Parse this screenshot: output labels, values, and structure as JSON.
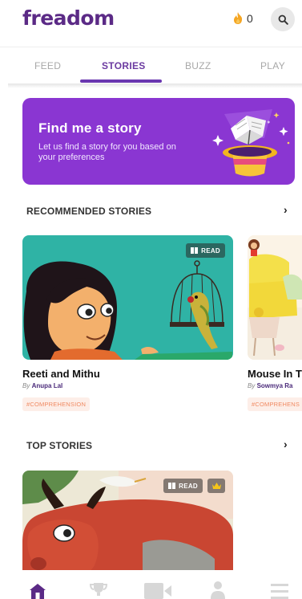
{
  "header": {
    "logo_text": "freadom",
    "coins_count": "0",
    "icons": {
      "coins": "flame-icon",
      "search": "search-icon"
    }
  },
  "tabs": [
    {
      "label": "FEED",
      "active": false
    },
    {
      "label": "STORIES",
      "active": true
    },
    {
      "label": "BUZZ",
      "active": false
    },
    {
      "label": "PLAY",
      "active": false
    }
  ],
  "banner": {
    "title": "Find me a story",
    "subtitle": "Let us find a story for you based on your preferences",
    "icon": "magic-hat-book-icon",
    "background_color": "#8a36d2"
  },
  "recommended": {
    "title": "RECOMMENDED STORIES",
    "chevron": "›",
    "cards": [
      {
        "title": "Reeti and Mithu",
        "by_label": "By",
        "author": "Anupa Lal",
        "tag": "#COMPREHENSION",
        "badge": "READ"
      },
      {
        "title": "Mouse In T",
        "by_label": "By",
        "author": "Sowmya Ra",
        "tag": "#COMPREHENS",
        "badge": ""
      }
    ]
  },
  "top_stories": {
    "title": "TOP STORIES",
    "chevron": "›",
    "cards": [
      {
        "badge": "READ",
        "premium_icon": "crown-icon"
      }
    ]
  },
  "bottom_nav": {
    "items": [
      {
        "icon": "home-icon",
        "active": true
      },
      {
        "icon": "trophy-icon",
        "active": false
      },
      {
        "icon": "video-camera-icon",
        "active": false
      },
      {
        "icon": "profile-icon",
        "active": false
      },
      {
        "icon": "menu-icon",
        "active": false
      }
    ]
  },
  "colors": {
    "brand": "#5b2a86",
    "accent": "#6a37b0",
    "tag_text": "#f08a62",
    "tag_bg": "#fdeee8"
  }
}
